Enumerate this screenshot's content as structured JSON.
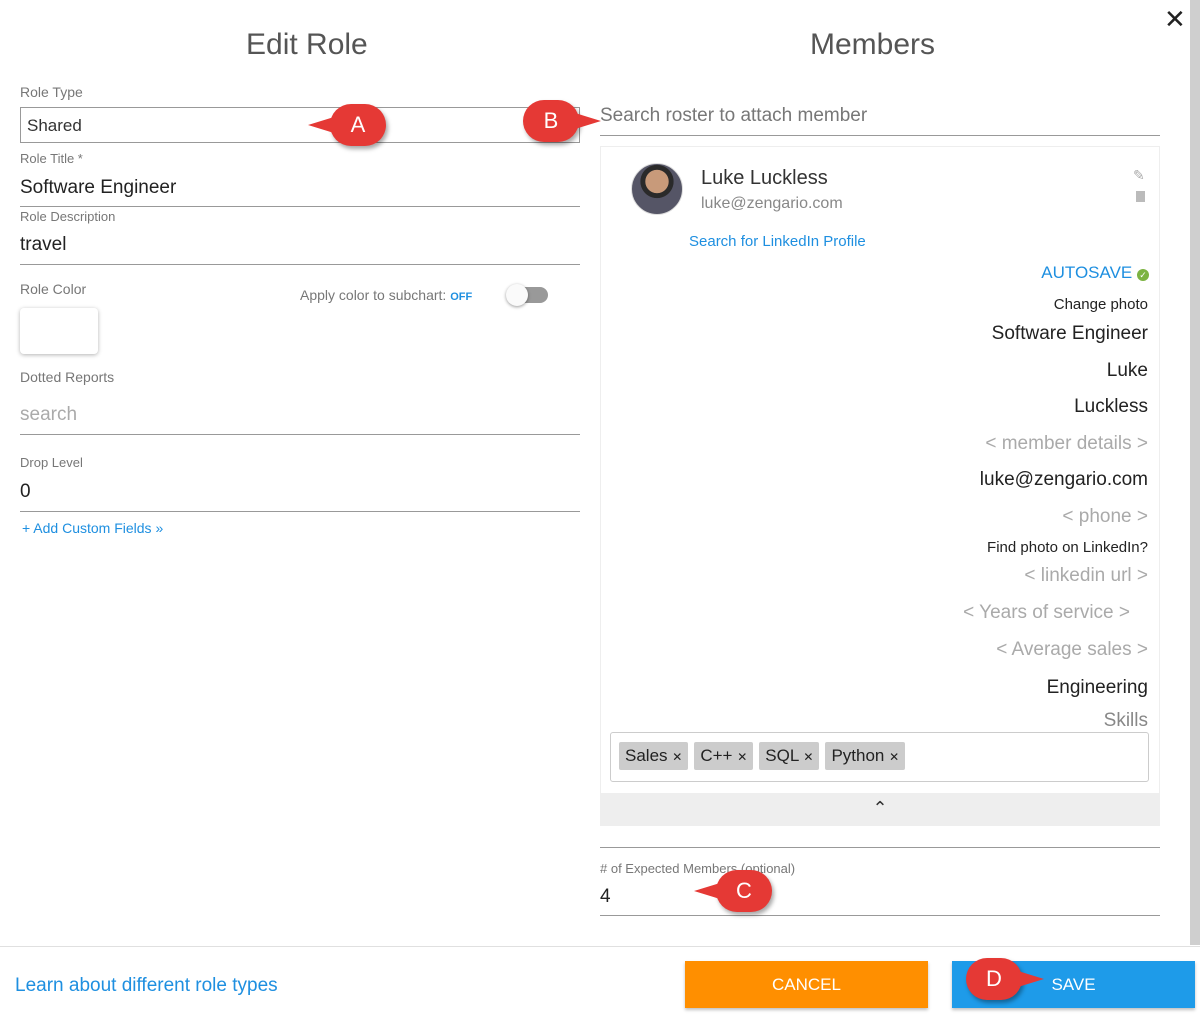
{
  "left": {
    "title": "Edit Role",
    "role_type_label": "Role Type",
    "role_type_value": "Shared",
    "role_title_label": "Role Title *",
    "role_title_value": "Software Engineer",
    "role_desc_label": "Role Description",
    "role_desc_value": "travel",
    "role_color_label": "Role Color",
    "apply_color_label": "Apply color to subchart:",
    "apply_color_state": "OFF",
    "dotted_label": "Dotted Reports",
    "dotted_placeholder": "search",
    "drop_label": "Drop Level",
    "drop_value": "0",
    "add_custom": "+  Add Custom Fields »"
  },
  "right": {
    "title": "Members",
    "search_placeholder": "Search roster to attach member",
    "member": {
      "name": "Luke Luckless",
      "email": "luke@zengario.com",
      "linkedin_search": "Search for LinkedIn Profile",
      "autosave": "AUTOSAVE",
      "change_photo": "Change photo",
      "role": "Software Engineer",
      "first": "Luke",
      "last": "Luckless",
      "details": "< member details >",
      "email2": "luke@zengario.com",
      "phone": "< phone >",
      "find_photo": "Find photo on LinkedIn?",
      "linkedin_url": "< linkedin url >",
      "years": "< Years of service >",
      "sales": "< Average sales >",
      "dept": "Engineering",
      "skills_label": "Skills",
      "skills": [
        "Sales",
        "C++",
        "SQL",
        "Python"
      ]
    },
    "expected_label": "# of Expected Members (optional)",
    "expected_value": "4"
  },
  "footer": {
    "learn": "Learn about different role types",
    "cancel": "CANCEL",
    "save": "SAVE"
  },
  "callouts": [
    "A",
    "B",
    "C",
    "D"
  ],
  "colors": {
    "accent": "#1e8fe0",
    "cancel": "#ff8f00",
    "save": "#1e9be9",
    "callout": "#e53935",
    "autosave_ok": "#7cb342"
  }
}
